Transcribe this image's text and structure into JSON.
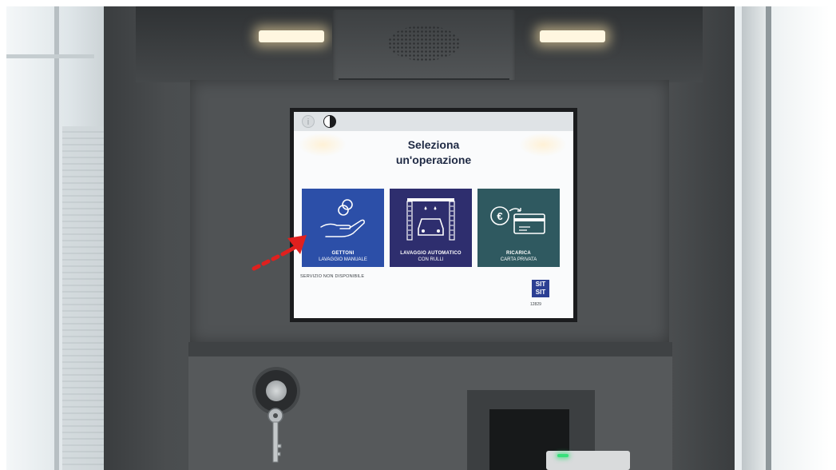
{
  "screen": {
    "title_line1": "Seleziona",
    "title_line2": "un'operazione",
    "info_icon": "info-icon",
    "contrast_icon": "contrast-icon",
    "tiles": [
      {
        "line1": "GETTONI",
        "line2": "LAVAGGIO MANUALE",
        "icon": "hand-coins-icon",
        "color": "#2c4fa8"
      },
      {
        "line1": "LAVAGGIO AUTOMATICO",
        "line2": "CON RULLI",
        "icon": "car-wash-icon",
        "color": "#2e2e6e"
      },
      {
        "line1": "RICARICA",
        "line2": "CARTA PRIVATA",
        "icon": "euro-card-icon",
        "color": "#2f5960"
      }
    ],
    "unavailable_text": "SERVIZIO NON DISPONIBILE",
    "logo_text": "SIT",
    "logo_number": "12829"
  },
  "annotation": {
    "icon": "red-dotted-arrow-icon",
    "color": "#e0201e"
  },
  "kiosk": {
    "key_icon": "key-icon",
    "lock_icon": "lock-icon",
    "reader_led_color": "#37e07a"
  }
}
